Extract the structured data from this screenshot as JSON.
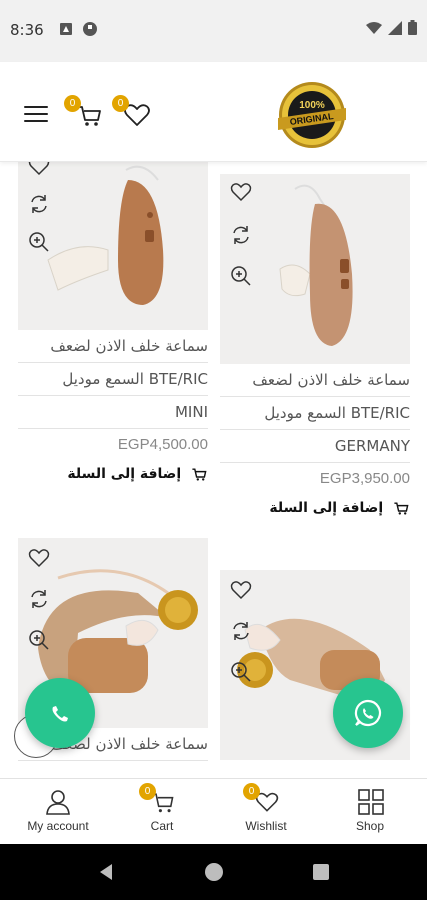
{
  "status_bar": {
    "time": "8:36"
  },
  "header": {
    "cart_count": "0",
    "wishlist_count": "0",
    "logo_text": "100% ORIGINAL"
  },
  "products": [
    {
      "line1": "سماعة خلف الاذن لضعف",
      "line2": "السمع موديل BTE/RIC",
      "line3": "MINI",
      "price": "EGP4,500.00",
      "add_to_cart": "إضافة إلى السلة"
    },
    {
      "line1": "سماعة خلف الاذن لضعف",
      "line2": "السمع موديل BTE/RIC",
      "line3": "GERMANY",
      "price": "EGP3,950.00",
      "add_to_cart": "إضافة إلى السلة"
    },
    {
      "line1": "سماعة خلف الاذن لضعف",
      "line2": "",
      "line3": "",
      "price": "",
      "add_to_cart": ""
    },
    {
      "line1": "",
      "line2": "",
      "line3": "",
      "price": "",
      "add_to_cart": ""
    }
  ],
  "bottom_nav": {
    "account": "My account",
    "cart": "Cart",
    "wishlist": "Wishlist",
    "shop": "Shop",
    "cart_count": "0",
    "wishlist_count": "0"
  },
  "icons": {
    "menu": "hamburger-icon",
    "cart": "cart-icon",
    "wishlist": "heart-icon",
    "compare": "refresh-icon",
    "zoom": "zoom-in-icon",
    "call": "phone-icon",
    "whatsapp": "whatsapp-icon"
  },
  "colors": {
    "accent": "#27c58f",
    "badge": "#e2a400",
    "price": "#888888"
  }
}
